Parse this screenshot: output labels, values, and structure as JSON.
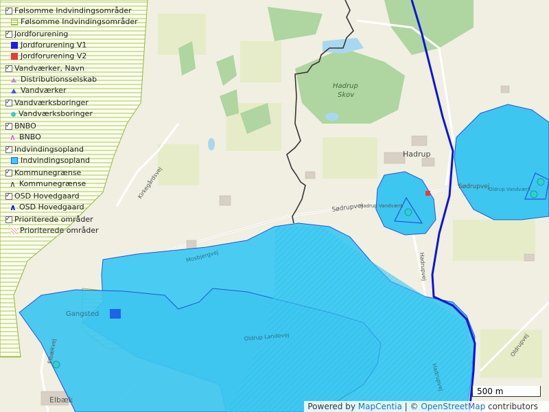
{
  "legend": {
    "groups": [
      {
        "title": "Følsomme Indvindingsområder",
        "item": "Følsomme Indvindingsområder",
        "color": "#9bc33a",
        "symbol": "hatch-green"
      },
      {
        "title": "Jordforurening",
        "items": [
          {
            "label": "Jordforurening V1",
            "color": "#1e1ee6",
            "symbol": "square"
          },
          {
            "label": "Jordforurening V2",
            "color": "#e63c3c",
            "symbol": "square"
          }
        ]
      },
      {
        "title": "Vandværker, Navn",
        "items": [
          {
            "label": "Distributionsselskab",
            "color": "#b38fd6",
            "symbol": "triangle"
          },
          {
            "label": "Vandværker",
            "color": "#3c5ae6",
            "symbol": "triangle"
          }
        ]
      },
      {
        "title": "Vandværksboringer",
        "item": "Vandværksboringer",
        "color": "#2ed0d0",
        "symbol": "circle"
      },
      {
        "title": "BNBO",
        "item": "BNBO",
        "color": "#e63ce6",
        "symbol": "line"
      },
      {
        "title": "Indvindingsopland",
        "item": "Indvindingsopland",
        "color": "#42c8f4",
        "symbol": "square"
      },
      {
        "title": "Kommunegrænse",
        "item": "Kommunegrænse",
        "color": "#333333",
        "symbol": "line"
      },
      {
        "title": "OSD Hovedgaard",
        "item": "OSD Hovedgaard",
        "color": "#0a14dc",
        "symbol": "line"
      },
      {
        "title": "Prioriterede områder",
        "item": "Prioriterede områder",
        "color": "#e8a0a0",
        "symbol": "hatch-pink"
      }
    ]
  },
  "map_labels": {
    "hadrup_skov_1": "Hadrup",
    "hadrup_skov_2": "Skov",
    "hadrup": "Hadrup",
    "sodrupvej_1": "Sødrupvej",
    "sodrupvej_2": "Sødrupvej",
    "hadrup_vandvaerk": "Hadrup Vandværk",
    "oldrup_vandvaerk": "Oldrup Vandværk",
    "kirkegaardsvej": "Kirkegårdsvej",
    "mosbjergvej": "Mosbjergvej",
    "gangsted": "Gangsted",
    "elbaekvej": "Elbækvej",
    "elbaek": "Elbæk",
    "oldrup_landevej": "Oldrup Landevej",
    "hadrupvej_1": "Hadrupvej",
    "hadrupvej_2": "Hadrupvej",
    "oldrupvej": "Oldrupvej"
  },
  "scale": {
    "label": "500 m"
  },
  "attribution": {
    "powered_by": "Powered by",
    "mapcentia": "MapCentia",
    "separator": " | © ",
    "osm": "OpenStreetMap",
    "contributors": " contributors"
  },
  "colors": {
    "water_area": "#3cc8f0",
    "osd_line": "#0a14dc",
    "kommune_line": "#333333",
    "forest": "#a8d49a",
    "fields": "#eef0d8",
    "fi_hatch": "#9bc33a"
  }
}
